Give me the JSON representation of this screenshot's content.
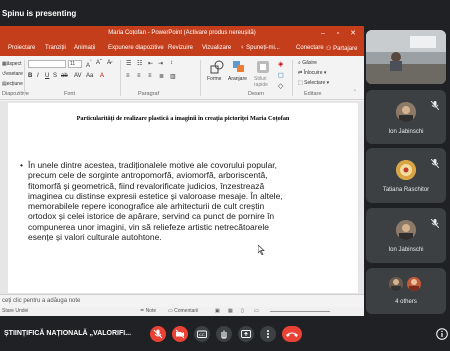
{
  "presenting": {
    "text": "Spinu is presenting"
  },
  "powerpoint": {
    "window_title": "Maria Coțofan - PowerPoint (Activare produs nereușită)",
    "tabs": [
      "Proiectare",
      "Tranziții",
      "Animații",
      "Expunere diapozitive",
      "Revizuire",
      "Vizualizare",
      "Spuneți-mi...",
      "Conectare",
      "Partajare"
    ],
    "ribbon": {
      "font_size": "11",
      "layout_label": "ăspect",
      "reset_label": "esetare",
      "section_label": "ecțiune",
      "groups": [
        "Diapozitive",
        "Font",
        "Paragraf",
        "Desen",
        "Editare"
      ],
      "drawing": {
        "shapes": "Forme",
        "arrange": "Aranjare",
        "quick_styles": "Stiluri rapide"
      },
      "editing": {
        "find": "Găsire",
        "replace": "Înlocuire",
        "select": "Selectare"
      }
    },
    "slide": {
      "title": "Particularități de realizare plastică a imaginii în creația pictoriței Maria Coțofan",
      "bullet_lines": [
        "În unele dintre acestea, tradiționalele motive ale covorului popular,",
        "precum cele de sorginte antropomorfă, aviomorfă, arboriscentă,",
        "fitomorfă și geometrică, fiind revalorificate judicios, înzestrează",
        "imaginea cu distinse expresii estetice și valoroase mesaje. În altele,",
        "memorabilele repere iconografice ale arhitecturii de cult creștin",
        "ortodox și celei istorice de apărare, servind ca punct de pornire în",
        "compunerea unor imagini, vin să reliefeze artistic netrecătoarele",
        "esențe și valori culturale autohtone."
      ]
    },
    "notes_placeholder": "ceți clic pentru a adăuga note",
    "status": {
      "left": "Stare Undei",
      "notes": "Note",
      "comments": "Comentarii"
    }
  },
  "participants": [
    {
      "name": ""
    },
    {
      "name": "Ion Jabinschi"
    },
    {
      "name": "Tatiana Raschitor"
    },
    {
      "name": "Ion Jabinschi"
    },
    {
      "name": "4 others"
    }
  ],
  "meeting": {
    "name": "ȘTIINȚIFICĂ NAȚIONALĂ „VALORIFI..."
  },
  "colors": {
    "powerpoint_accent": "#c43e1c",
    "meet_bg": "#202124",
    "tile_bg": "#3c4043",
    "danger": "#ea4335"
  }
}
